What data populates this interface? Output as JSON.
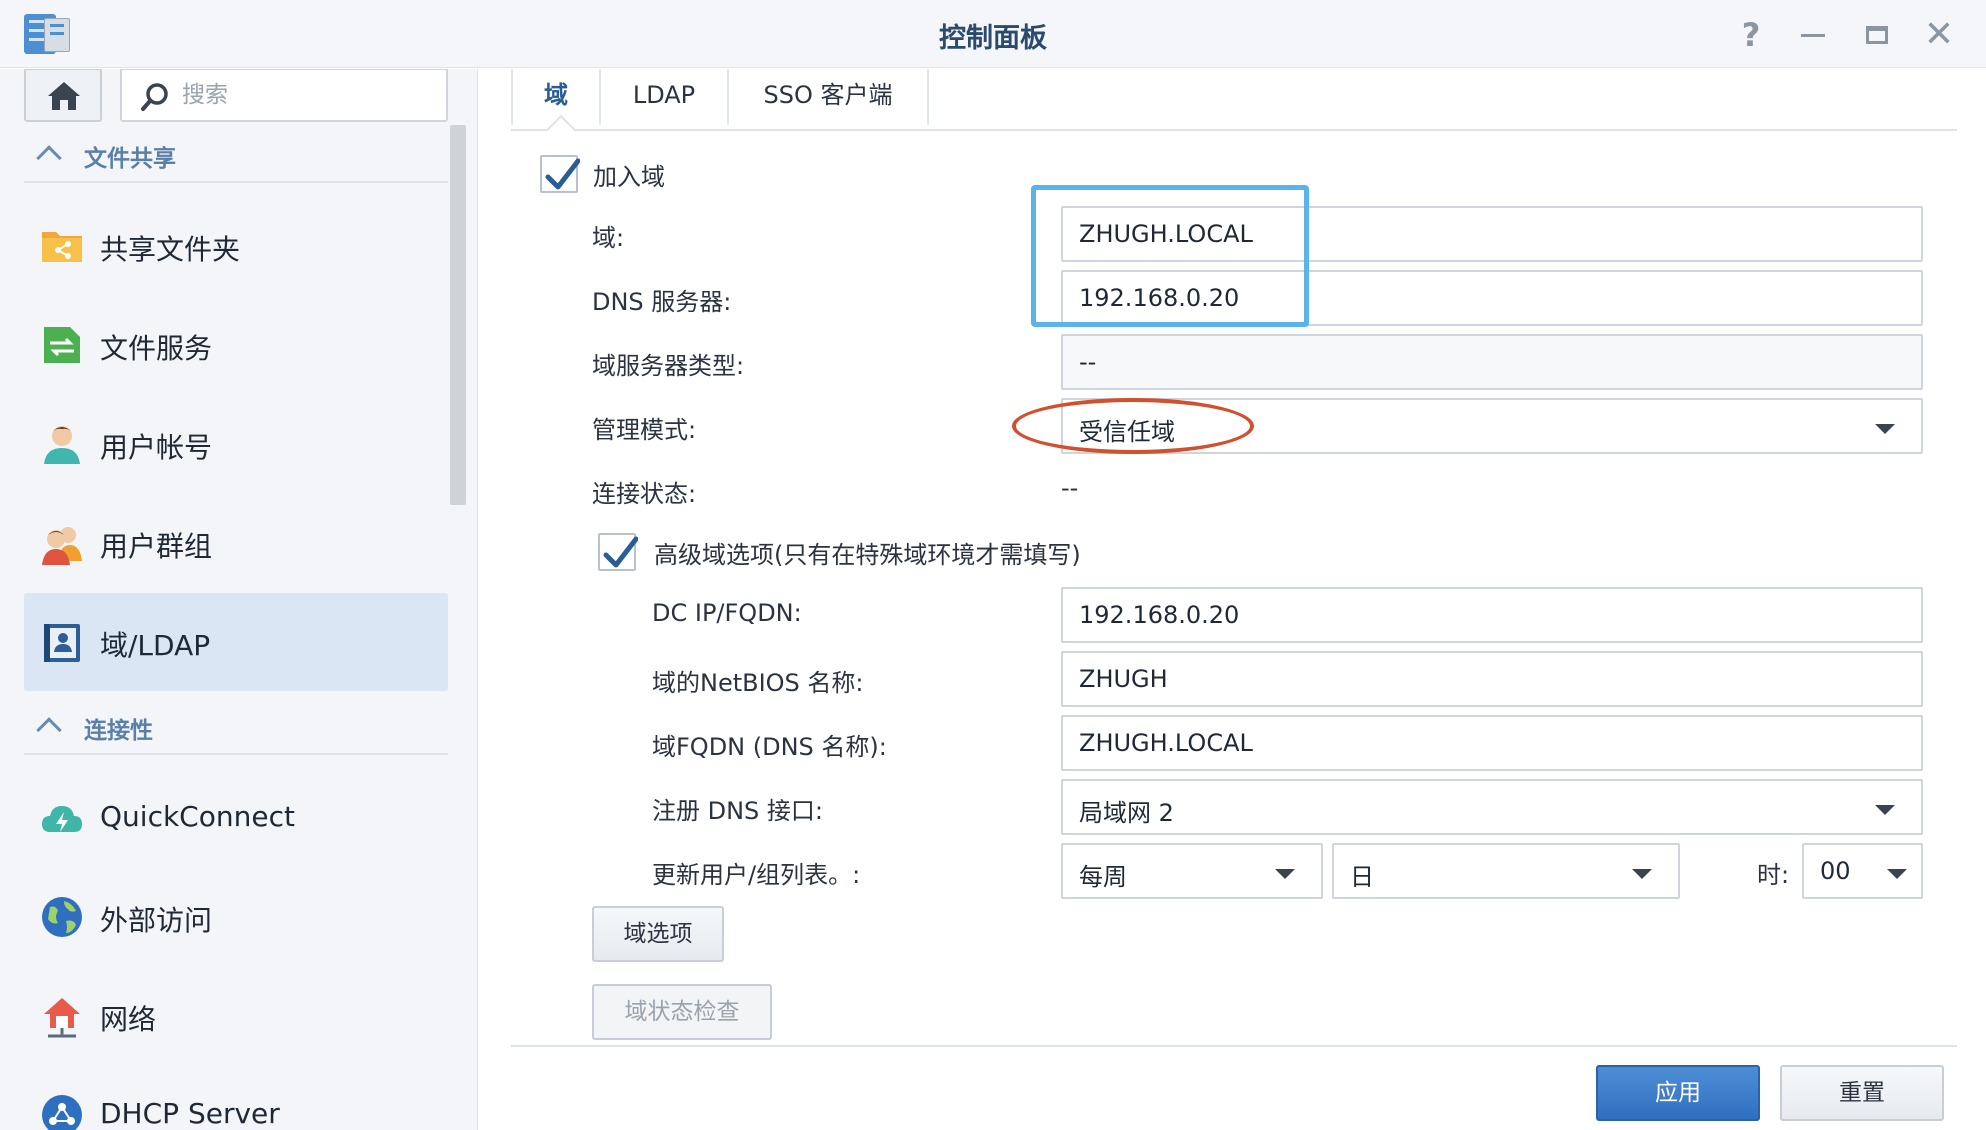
{
  "window": {
    "title": "控制面板",
    "help_icon": "question-icon",
    "minimize_icon": "minimize-icon",
    "maximize_icon": "maximize-icon",
    "close_icon": "close-icon"
  },
  "sidebar": {
    "search_placeholder": "搜索",
    "sections": [
      {
        "label": "文件共享"
      },
      {
        "label": "连接性"
      }
    ],
    "items": [
      {
        "label": "共享文件夹",
        "icon": "shared-folder-icon"
      },
      {
        "label": "文件服务",
        "icon": "file-services-icon"
      },
      {
        "label": "用户帐号",
        "icon": "user-icon"
      },
      {
        "label": "用户群组",
        "icon": "group-icon"
      },
      {
        "label": "域/LDAP",
        "icon": "domain-ldap-icon",
        "active": true
      },
      {
        "label": "QuickConnect",
        "icon": "quickconnect-icon"
      },
      {
        "label": "外部访问",
        "icon": "external-access-icon"
      },
      {
        "label": "网络",
        "icon": "network-icon"
      },
      {
        "label": "DHCP Server",
        "icon": "dhcp-server-icon"
      }
    ]
  },
  "tabs": [
    {
      "label": "域",
      "active": true
    },
    {
      "label": "LDAP"
    },
    {
      "label": "SSO 客户端"
    }
  ],
  "form": {
    "join_domain": {
      "label": "加入域",
      "checked": true
    },
    "domain": {
      "label": "域:",
      "value": "ZHUGH.LOCAL"
    },
    "dns_server": {
      "label": "DNS 服务器:",
      "value": "192.168.0.20"
    },
    "domain_server_type": {
      "label": "域服务器类型:",
      "value": "--"
    },
    "management_mode": {
      "label": "管理模式:",
      "value": "受信任域"
    },
    "connection_status": {
      "label": "连接状态:",
      "value": "--"
    },
    "advanced": {
      "label": "高级域选项(只有在特殊域环境才需填写)",
      "checked": true
    },
    "dc_ip": {
      "label": "DC IP/FQDN:",
      "value": "192.168.0.20"
    },
    "netbios": {
      "label": "域的NetBIOS 名称:",
      "value": "ZHUGH"
    },
    "fqdn": {
      "label": "域FQDN (DNS 名称):",
      "value": "ZHUGH.LOCAL"
    },
    "register_dns": {
      "label": "注册 DNS 接口:",
      "value": "局域网 2"
    },
    "update_list": {
      "label": "更新用户/组列表。:",
      "frequency": "每周",
      "day": "日",
      "hour_label": "时:",
      "hour": "00"
    },
    "domain_options_button": "域选项",
    "domain_status_button": "域状态检查"
  },
  "footer": {
    "apply": "应用",
    "reset": "重置"
  },
  "colors": {
    "accent": "#2f6fbf",
    "highlight_box": "#5ab4ea",
    "highlight_ellipse": "#d1502e",
    "active_nav": "#dbe6f4"
  }
}
